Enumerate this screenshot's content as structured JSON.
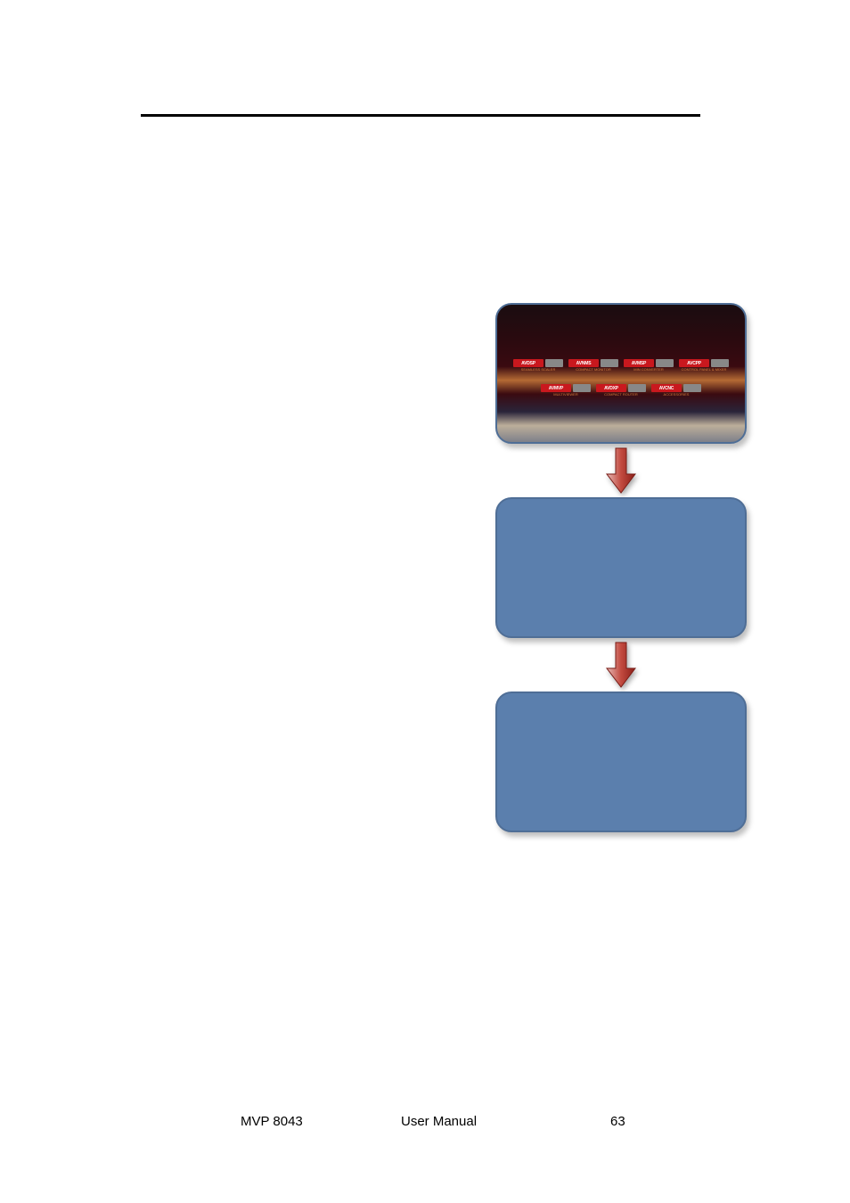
{
  "footer": {
    "model": "MVP 8043",
    "title": "User Manual",
    "page": "63"
  },
  "diagram": {
    "tiles_top": [
      {
        "badge": "AVDSP",
        "sub": "SEAMLESS SCALER"
      },
      {
        "badge": "AVNMS",
        "sub": "COMPACT MONITOR"
      },
      {
        "badge": "AVMSP",
        "sub": "MIN CONVERTER"
      },
      {
        "badge": "AVCPP",
        "sub": "CONTROL PANEL & MIXER"
      }
    ],
    "tiles_bot": [
      {
        "badge": "AVMVP",
        "sub": "MULTIVIEWER"
      },
      {
        "badge": "AVDXP",
        "sub": "COMPACT ROUTER"
      },
      {
        "badge": "AVCNC",
        "sub": "ACCESSORIES"
      }
    ]
  }
}
